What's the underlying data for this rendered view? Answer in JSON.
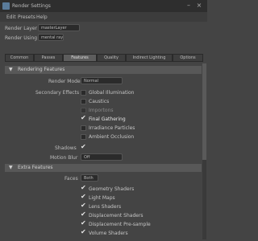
{
  "window": {
    "title": "Render Settings"
  },
  "menu": [
    "Edit",
    "Presets",
    "Help"
  ],
  "render_layer": {
    "label": "Render Layer",
    "value": "masterLayer"
  },
  "render_using": {
    "label": "Render Using",
    "value": "mental ray"
  },
  "tabs": [
    "Common",
    "Passes",
    "Features",
    "Quality",
    "Indirect Lighting",
    "Options"
  ],
  "active_tab": 2,
  "rendering_features": {
    "header": "Rendering Features",
    "render_mode": {
      "label": "Render Mode",
      "value": "Normal"
    },
    "secondary_effects_label": "Secondary Effects",
    "effects": [
      {
        "label": "Global Illumination",
        "checked": false,
        "enabled": true
      },
      {
        "label": "Caustics",
        "checked": false,
        "enabled": true
      },
      {
        "label": "Importons",
        "checked": false,
        "enabled": false
      },
      {
        "label": "Final Gathering",
        "checked": true,
        "enabled": true
      },
      {
        "label": "Irradiance Particles",
        "checked": false,
        "enabled": true
      },
      {
        "label": "Ambient Occlusion",
        "checked": false,
        "enabled": true
      }
    ],
    "shadows": {
      "label": "Shadows",
      "checked": true
    },
    "motion_blur": {
      "label": "Motion Blur",
      "value": "Off"
    }
  },
  "extra_features": {
    "header": "Extra Features",
    "faces": {
      "label": "Faces",
      "value": "Both"
    },
    "items": [
      {
        "label": "Geometry Shaders",
        "checked": true
      },
      {
        "label": "Light Maps",
        "checked": true
      },
      {
        "label": "Lens Shaders",
        "checked": true
      },
      {
        "label": "Displacement Shaders",
        "checked": true
      },
      {
        "label": "Displacement Pre-sample",
        "checked": true
      },
      {
        "label": "Volume Shaders",
        "checked": true
      }
    ]
  },
  "colors": {
    "bg": "#444444",
    "header": "#585858",
    "field": "#2b2b2b"
  }
}
